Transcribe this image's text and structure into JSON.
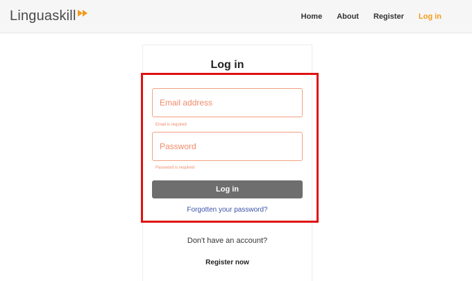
{
  "header": {
    "logo_text": "Linguaskill",
    "logo_icon": "double-arrow-icon",
    "nav": [
      {
        "label": "Home"
      },
      {
        "label": "About"
      },
      {
        "label": "Register"
      },
      {
        "label": "Log in"
      }
    ]
  },
  "login": {
    "title": "Log in",
    "email_placeholder": "Email address",
    "email_error": "Email is required",
    "password_placeholder": "Password",
    "password_error": "Password is required",
    "submit_label": "Log in",
    "forgot_link": "Forgotten your password?"
  },
  "register": {
    "prompt": "Don't have an account?",
    "link": "Register now"
  },
  "colors": {
    "accent": "#f59a1b",
    "error": "#f08a6a",
    "button": "#6e6e6e",
    "link": "#3b52a8",
    "highlight": "#e01010"
  }
}
